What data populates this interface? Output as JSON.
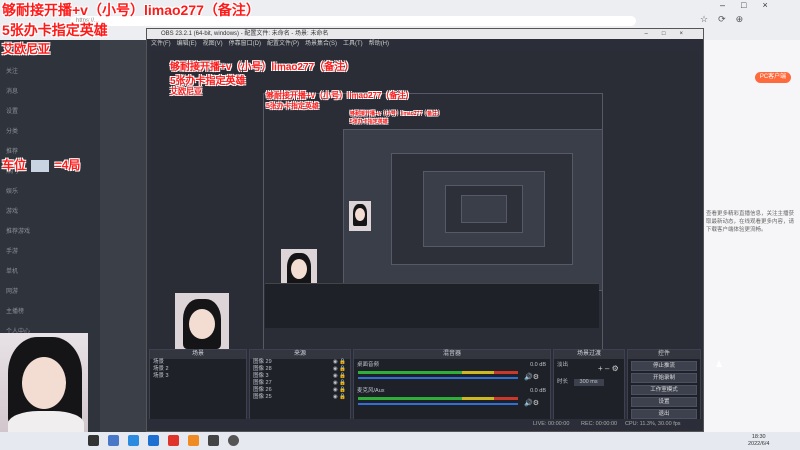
{
  "overlay": {
    "line1": "够耐接开播+v（小号）limao277（备注）",
    "line2": "5张办卡指定英雄",
    "line3": "艾欧尼亚",
    "rank_label": "车位",
    "rank_suffix": "=4局"
  },
  "browser": {
    "url": "https://...",
    "pc_badge": "PC客户端",
    "right_text": "查看更多精彩直播信息，关注主播获取最新动态，在线观看更多内容，请下载客户端体验更流畅。"
  },
  "left_panel": {
    "items": [
      "关注",
      "消息",
      "设置",
      "分类",
      "推荐",
      "热门",
      "娱乐",
      "游戏",
      "推荐游戏",
      "手游",
      "单机",
      "网游",
      "主播榜",
      "个人中心"
    ]
  },
  "obs": {
    "title": "OBS 23.2.1 (64-bit, windows) - 配置文件: 未命名 - 场景: 未命名",
    "menu": [
      "文件(F)",
      "编辑(E)",
      "视图(V)",
      "停靠窗口(D)",
      "配置文件(P)",
      "场景集合(S)",
      "工具(T)",
      "帮助(H)"
    ],
    "panels": {
      "scenes": {
        "title": "场景",
        "items": [
          "场景",
          "场景 2",
          "场景 3"
        ]
      },
      "sources": {
        "title": "来源",
        "items": [
          "图像 29",
          "图像 28",
          "图像 3",
          "图像 27",
          "图像 26",
          "图像 25"
        ]
      },
      "mixer": {
        "title": "混音器",
        "tracks": [
          {
            "name": "桌面音频",
            "value": "0.0 dB"
          },
          {
            "name": "麦克风/Aux",
            "value": "0.0 dB"
          }
        ]
      },
      "transitions": {
        "title": "场景过渡",
        "type": "淡出",
        "duration_label": "时长",
        "duration": "300 ms"
      },
      "controls": {
        "title": "控件",
        "buttons": [
          "停止推流",
          "开始录制",
          "工作室模式",
          "设置",
          "退出"
        ]
      }
    },
    "status": {
      "live": "LIVE: 00:00:00",
      "rec": "REC: 00:00:00",
      "cpu": "CPU: 11.3%, 30.00 fps"
    }
  },
  "taskbar": {
    "time": "18:30",
    "date": "2022/6/4"
  }
}
